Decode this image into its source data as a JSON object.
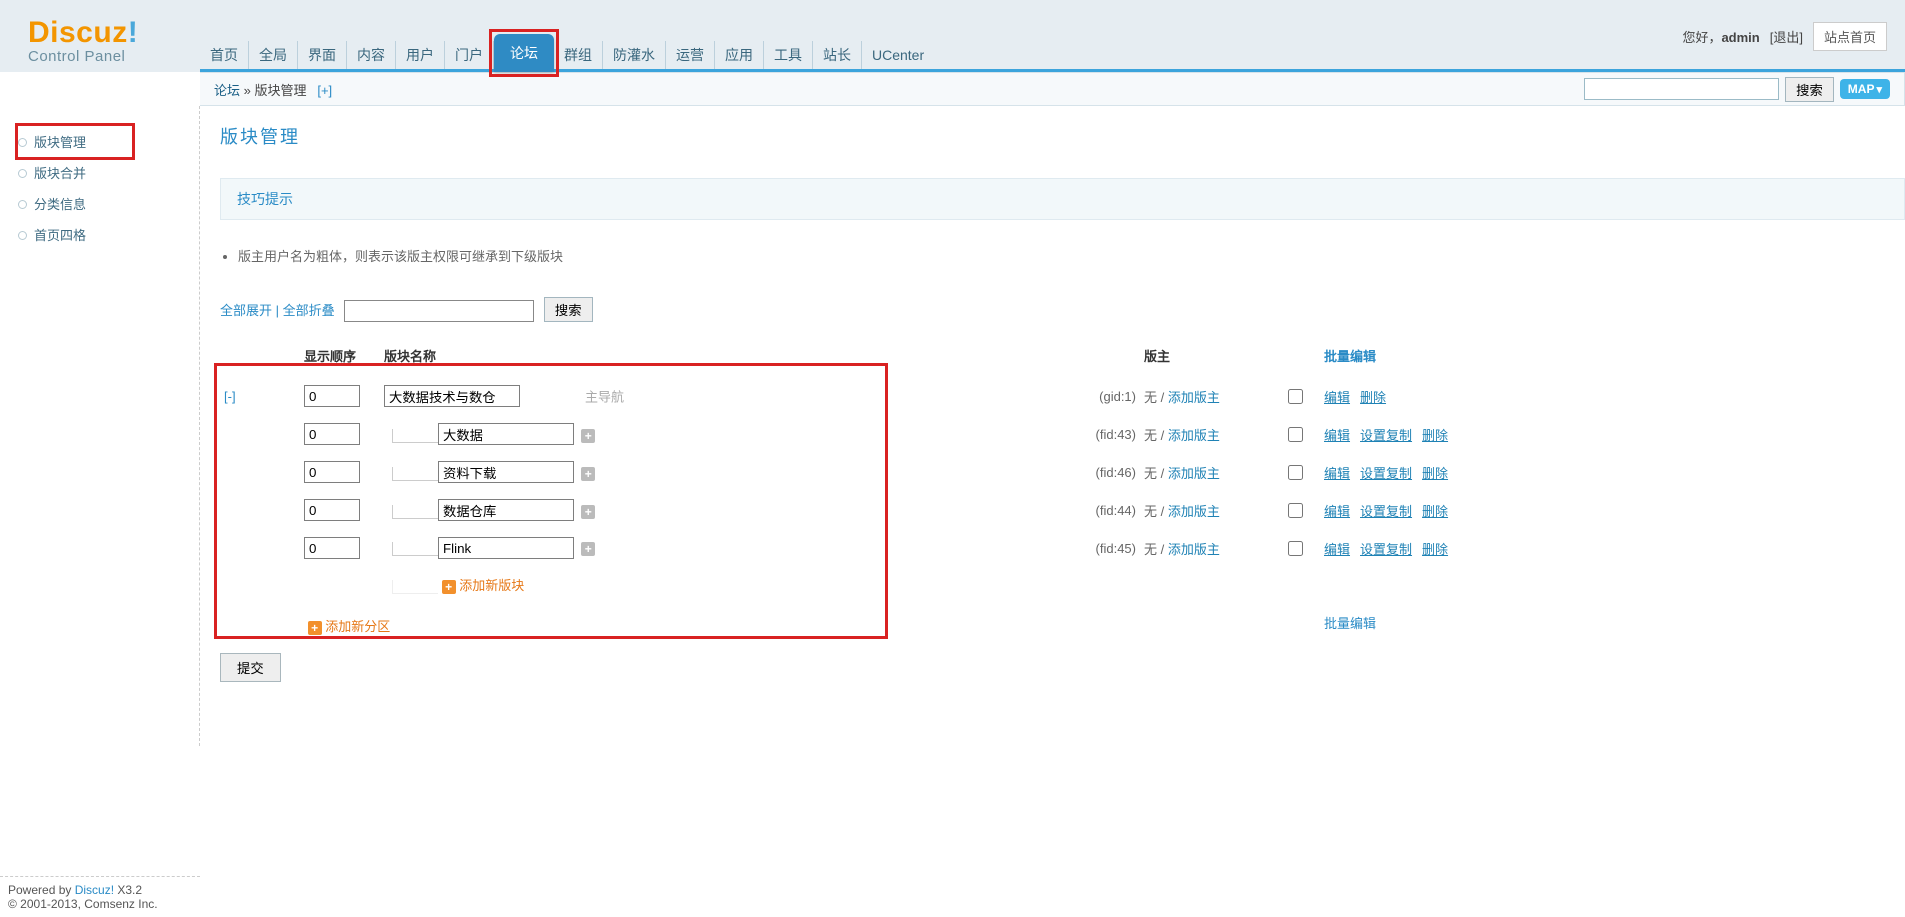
{
  "header": {
    "logo_main": "Discuz",
    "logo_excl": "!",
    "logo_sub": "Control Panel",
    "greeting_prefix": "您好，",
    "user": "admin",
    "logout": "[退出]",
    "site_home": "站点首页"
  },
  "topnav": {
    "items": [
      {
        "label": "首页",
        "active": false
      },
      {
        "label": "全局",
        "active": false
      },
      {
        "label": "界面",
        "active": false
      },
      {
        "label": "内容",
        "active": false
      },
      {
        "label": "用户",
        "active": false
      },
      {
        "label": "门户",
        "active": false
      },
      {
        "label": "论坛",
        "active": true
      },
      {
        "label": "群组",
        "active": false
      },
      {
        "label": "防灌水",
        "active": false
      },
      {
        "label": "运营",
        "active": false
      },
      {
        "label": "应用",
        "active": false
      },
      {
        "label": "工具",
        "active": false
      },
      {
        "label": "站长",
        "active": false
      },
      {
        "label": "UCenter",
        "active": false
      }
    ]
  },
  "breadcrumb": {
    "root": "论坛",
    "sep": " » ",
    "current": "版块管理",
    "plus": "[+]"
  },
  "subbar": {
    "search_value": "",
    "search_btn": "搜索",
    "map_btn": "MAP"
  },
  "sidebar": {
    "items": [
      {
        "label": "版块管理",
        "highlight": true
      },
      {
        "label": "版块合并",
        "highlight": false
      },
      {
        "label": "分类信息",
        "highlight": false
      },
      {
        "label": "首页四格",
        "highlight": false
      }
    ]
  },
  "page": {
    "title": "版块管理",
    "tipbox": "技巧提示",
    "tips": [
      "版主用户名为粗体，则表示该版主权限可继承到下级版块"
    ],
    "expand_all": "全部展开",
    "collapse_all": "全部折叠",
    "filter_value": "",
    "filter_btn": "搜索",
    "columns": {
      "order": "显示顺序",
      "name": "版块名称",
      "mod": "版主",
      "batch": "批量编辑"
    },
    "collapse_toggle": "[-]",
    "group": {
      "order": "0",
      "name": "大数据技术与数仓",
      "mainnav": "主导航",
      "id": "(gid:1)",
      "mod_none": "无",
      "mod_sep": " / ",
      "mod_add": "添加版主",
      "edit": "编辑",
      "del": "删除"
    },
    "forums": [
      {
        "order": "0",
        "name": "大数据",
        "id": "(fid:43)",
        "mod_none": "无",
        "mod_add": "添加版主",
        "edit": "编辑",
        "copy": "设置复制",
        "del": "删除"
      },
      {
        "order": "0",
        "name": "资料下载",
        "id": "(fid:46)",
        "mod_none": "无",
        "mod_add": "添加版主",
        "edit": "编辑",
        "copy": "设置复制",
        "del": "删除"
      },
      {
        "order": "0",
        "name": "数据仓库",
        "id": "(fid:44)",
        "mod_none": "无",
        "mod_add": "添加版主",
        "edit": "编辑",
        "copy": "设置复制",
        "del": "删除"
      },
      {
        "order": "0",
        "name": "Flink",
        "id": "(fid:45)",
        "mod_none": "无",
        "mod_add": "添加版主",
        "edit": "编辑",
        "copy": "设置复制",
        "del": "删除"
      }
    ],
    "add_forum": "添加新版块",
    "add_group": "添加新分区",
    "batch_bottom": "批量编辑",
    "submit": "提交"
  },
  "footer": {
    "line1_pre": "Powered by ",
    "line1_link": "Discuz!",
    "line1_ver": " X3.2",
    "line2": "© 2001-2013, Comsenz Inc."
  }
}
